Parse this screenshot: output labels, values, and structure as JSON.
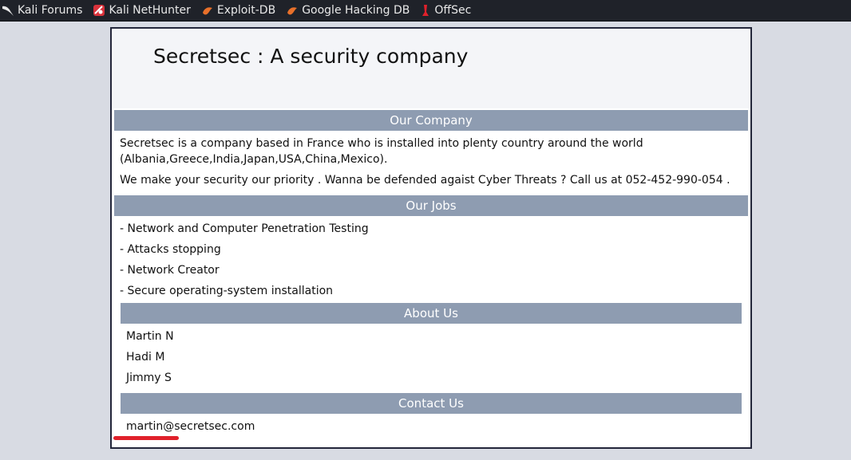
{
  "bookmarks": [
    {
      "label": "Kali Forums",
      "icon": "kali-dragon-icon"
    },
    {
      "label": "Kali NetHunter",
      "icon": "nethunter-icon"
    },
    {
      "label": "Exploit-DB",
      "icon": "exploit-db-icon"
    },
    {
      "label": "Google Hacking DB",
      "icon": "ghdb-icon"
    },
    {
      "label": "OffSec",
      "icon": "offsec-icon"
    }
  ],
  "site": {
    "title": "Secretsec : A security company"
  },
  "company": {
    "heading": "Our Company",
    "line1": "Secretsec is a company based in France who is installed into plenty country around the world",
    "line2": "(Albania,Greece,India,Japan,USA,China,Mexico).",
    "line3": "We make your security our priority . Wanna be defended agaist Cyber Threats ? Call us at 052-452-990-054 ."
  },
  "jobs": {
    "heading": "Our Jobs",
    "items": [
      "- Network and Computer Penetration Testing",
      "- Attacks stopping",
      "- Network Creator",
      "- Secure operating-system installation"
    ]
  },
  "about": {
    "heading": "About Us",
    "members": [
      "Martin N",
      "Hadi M",
      "Jimmy S"
    ]
  },
  "contact": {
    "heading": "Contact Us",
    "email": "martin@secretsec.com"
  },
  "colors": {
    "toolbar_bg": "#1f2229",
    "section_bar": "#8e9cb1",
    "annotation_red": "#e0212b"
  }
}
